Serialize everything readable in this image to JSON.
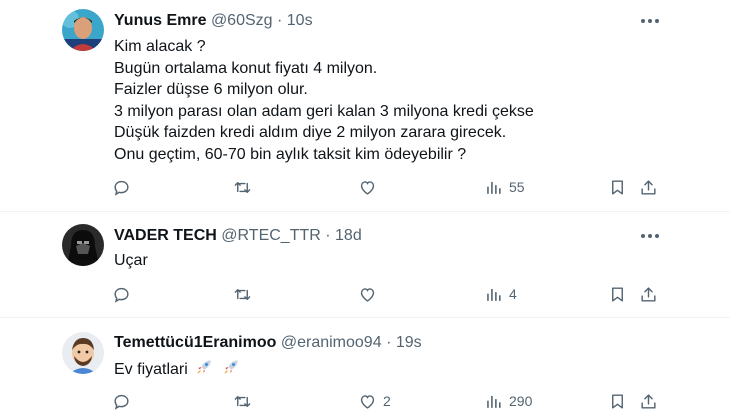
{
  "tweets": [
    {
      "name": "Yunus Emre",
      "handle": "@60Szg",
      "separator": "·",
      "time": "10s",
      "lines": [
        "Kim alacak ?",
        "Bugün ortalama konut fiyatı 4 milyon.",
        "Faizler düşse 6 milyon olur.",
        "3 milyon parası olan adam geri kalan 3 milyona kredi çekse",
        "Düşük faizden kredi aldım diye 2 milyon zarara girecek.",
        "Onu geçtim, 60-70 bin aylık taksit kim ödeyebilir ?"
      ],
      "replies": "",
      "retweets": "",
      "likes": "",
      "views": "55"
    },
    {
      "name": "VADER TECH",
      "handle": "@RTEC_TTR",
      "separator": "·",
      "time": "18d",
      "lines": [
        "Uçar"
      ],
      "replies": "",
      "retweets": "",
      "likes": "",
      "views": "4"
    },
    {
      "name": "Temettücü1Eranimoo",
      "handle": "@eranimoo94",
      "separator": "·",
      "time": "19s",
      "text": "Ev fiyatlari",
      "emojis": [
        "rocket-emoji",
        "rocket-emoji"
      ],
      "replies": "",
      "retweets": "",
      "likes": "2",
      "views": "290"
    }
  ],
  "icons": [
    "reply-icon",
    "retweet-icon",
    "like-icon",
    "views-icon",
    "bookmark-icon",
    "share-icon",
    "more-icon"
  ],
  "colors": {
    "text": "#0f1419",
    "secondary": "#536471",
    "divider": "#eff3f4"
  }
}
